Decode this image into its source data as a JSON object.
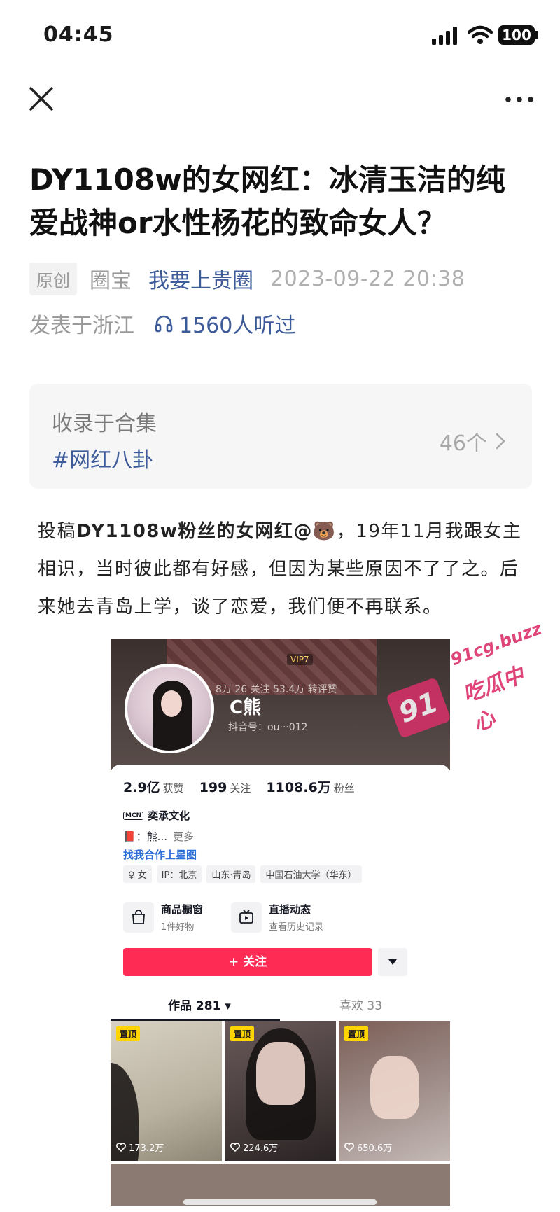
{
  "status_bar": {
    "time": "04:45",
    "battery": "100"
  },
  "article": {
    "title": "DY1108w的女网红：冰清玉洁的纯爱战神or水性杨花的致命女人？",
    "tag": "原创",
    "author": "圈宝",
    "circle": "我要上贵圈",
    "date": "2023-09-22 20:38",
    "location": "发表于浙江",
    "listens": "1560人听过"
  },
  "collection": {
    "label": "收录于合集",
    "name": "#网红八卦",
    "count": "46个"
  },
  "body": {
    "p_prefix": "投稿",
    "p_bold": "DY1108w粉丝的女网红@",
    "p_emoji": "🐻",
    "p_rest": "，19年11月我跟女主相识，当时彼此都有好感，但因为某些原因不了了之。后来她去青岛上学，谈了恋爱，我们便不再联系。"
  },
  "embedded_profile": {
    "nickname": "C熊",
    "douyin_id": "抖音号：ou···012",
    "top_stats": "8万   26 关注   53.4万 转评赞",
    "vip": "VIP7",
    "likes_num": "2.9亿",
    "likes_label": "获赞",
    "following_num": "199",
    "following_label": "关注",
    "fans_num": "1108.6万",
    "fans_label": "粉丝",
    "mcn": "奕承文化",
    "mcn_badge": "MCN",
    "bio": "📕：熊...",
    "bio_more": "更多",
    "star_link": "找我合作上星图",
    "chips": [
      "♀ 女",
      "IP：北京",
      "山东·青岛",
      "中国石油大学（华东）"
    ],
    "shop_title": "商品橱窗",
    "shop_sub": "1件好物",
    "live_title": "直播动态",
    "live_sub": "查看历史记录",
    "follow_label": "+ 关注",
    "tab_works": "作品 281 ▾",
    "tab_likes": "喜欢 33",
    "pin_label": "置顶",
    "videos": [
      {
        "likes": "173.2万"
      },
      {
        "likes": "224.6万"
      },
      {
        "likes": "650.6万"
      }
    ]
  },
  "watermark": {
    "number": "91",
    "url": "91cg.buzz",
    "text": "吃瓜中心"
  },
  "icons": [
    "close-icon",
    "more-icon",
    "headphones-icon",
    "chevron-right-icon",
    "signal-icon",
    "wifi-icon",
    "battery-icon"
  ]
}
